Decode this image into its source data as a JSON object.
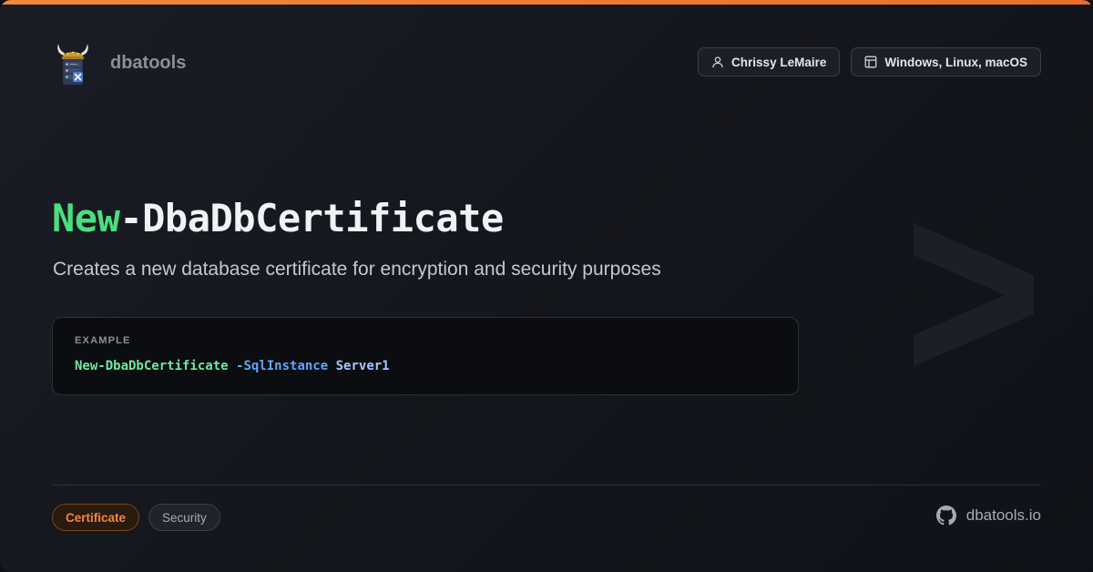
{
  "brand": {
    "name": "dbatools",
    "logo_icon": "viking-helmet-server-icon"
  },
  "header_chips": [
    {
      "label": "Chrissy LeMaire",
      "icon": "user-icon"
    },
    {
      "label": "Windows, Linux, macOS",
      "icon": "layout-icon"
    }
  ],
  "command": {
    "verb": "New",
    "noun": "-DbaDbCertificate",
    "description": "Creates a new database certificate for encryption and security purposes"
  },
  "example": {
    "label": "EXAMPLE",
    "command": "New-DbaDbCertificate",
    "parameter": "-SqlInstance",
    "value": "Server1"
  },
  "tags": [
    {
      "label": "Certificate",
      "style": "primary"
    },
    {
      "label": "Security",
      "style": "secondary"
    }
  ],
  "footer": {
    "site": "dbatools.io",
    "site_icon": "github-icon"
  },
  "colors": {
    "accent_orange": "#f0883e",
    "verb_green": "#4ade80",
    "param_blue": "#60a5fa",
    "background": "#14171d"
  }
}
